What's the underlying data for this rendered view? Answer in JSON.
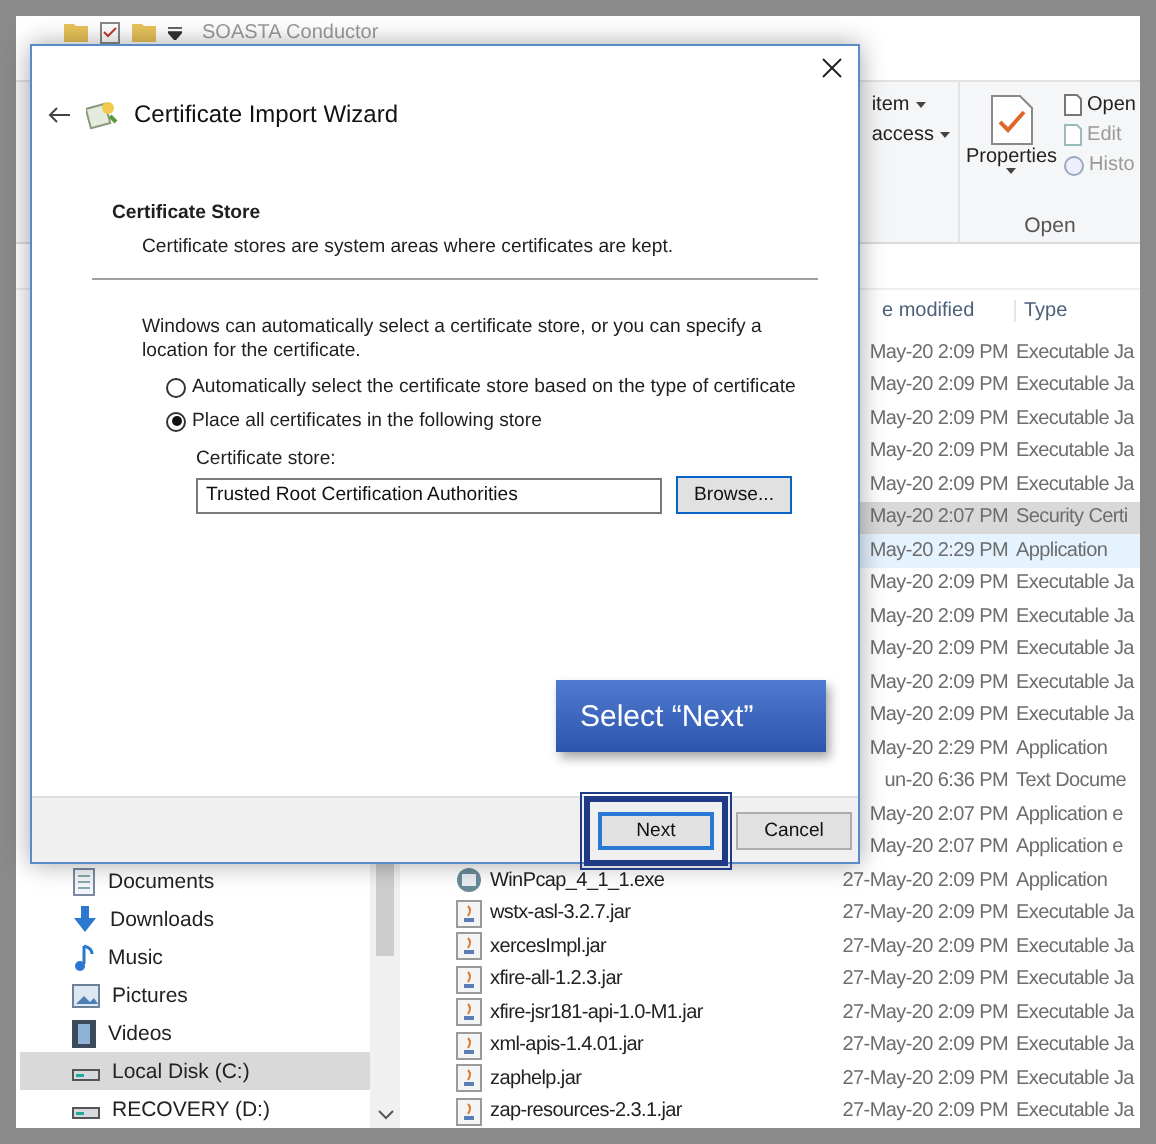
{
  "explorer": {
    "title": "SOASTA Conductor",
    "ribbon": {
      "new_item": "item",
      "easy_access": "access",
      "properties": "Properties",
      "open": "Open",
      "edit": "Edit",
      "history": "Histo",
      "group_label": "Open"
    },
    "columns": [
      "e modified",
      "Type"
    ],
    "sidebar": [
      {
        "label": "Documents",
        "kind": "documents",
        "selected": false
      },
      {
        "label": "Downloads",
        "kind": "downloads",
        "selected": false
      },
      {
        "label": "Music",
        "kind": "music",
        "selected": false
      },
      {
        "label": "Pictures",
        "kind": "pictures",
        "selected": false
      },
      {
        "label": "Videos",
        "kind": "videos",
        "selected": false
      },
      {
        "label": "Local Disk (C:)",
        "kind": "drive",
        "selected": true
      },
      {
        "label": "RECOVERY (D:)",
        "kind": "drive",
        "selected": false
      }
    ],
    "files": [
      {
        "date": "May-20 2:09 PM",
        "type": "Executable Ja",
        "selected": false,
        "hovered": false
      },
      {
        "date": "May-20 2:09 PM",
        "type": "Executable Ja",
        "selected": false,
        "hovered": false
      },
      {
        "date": "May-20 2:09 PM",
        "type": "Executable Ja",
        "selected": false,
        "hovered": false
      },
      {
        "date": "May-20 2:09 PM",
        "type": "Executable Ja",
        "selected": false,
        "hovered": false
      },
      {
        "date": "May-20 2:09 PM",
        "type": "Executable Ja",
        "selected": false,
        "hovered": false
      },
      {
        "date": "May-20 2:07 PM",
        "type": "Security Certi",
        "selected": true,
        "hovered": false
      },
      {
        "date": "May-20 2:29 PM",
        "type": "Application",
        "selected": false,
        "hovered": true
      },
      {
        "date": "May-20 2:09 PM",
        "type": "Executable Ja",
        "selected": false,
        "hovered": false
      },
      {
        "date": "May-20 2:09 PM",
        "type": "Executable Ja",
        "selected": false,
        "hovered": false
      },
      {
        "date": "May-20 2:09 PM",
        "type": "Executable Ja",
        "selected": false,
        "hovered": false
      },
      {
        "date": "May-20 2:09 PM",
        "type": "Executable Ja",
        "selected": false,
        "hovered": false
      },
      {
        "date": "May-20 2:09 PM",
        "type": "Executable Ja",
        "selected": false,
        "hovered": false
      },
      {
        "date": "May-20 2:29 PM",
        "type": "Application",
        "selected": false,
        "hovered": false
      },
      {
        "date": "un-20 6:36 PM",
        "type": "Text Docume",
        "selected": false,
        "hovered": false
      },
      {
        "date": "May-20 2:07 PM",
        "type": "Application e",
        "selected": false,
        "hovered": false
      },
      {
        "date": "May-20 2:07 PM",
        "type": "Application e",
        "selected": false,
        "hovered": false
      },
      {
        "name": "WinPcap_4_1_1.exe",
        "kind": "exe",
        "date": "27-May-20 2:09 PM",
        "type": "Application",
        "selected": false,
        "hovered": false
      },
      {
        "name": "wstx-asl-3.2.7.jar",
        "kind": "jar",
        "date": "27-May-20 2:09 PM",
        "type": "Executable Ja",
        "selected": false,
        "hovered": false
      },
      {
        "name": "xercesImpl.jar",
        "kind": "jar",
        "date": "27-May-20 2:09 PM",
        "type": "Executable Ja",
        "selected": false,
        "hovered": false
      },
      {
        "name": "xfire-all-1.2.3.jar",
        "kind": "jar",
        "date": "27-May-20 2:09 PM",
        "type": "Executable Ja",
        "selected": false,
        "hovered": false
      },
      {
        "name": "xfire-jsr181-api-1.0-M1.jar",
        "kind": "jar",
        "date": "27-May-20 2:09 PM",
        "type": "Executable Ja",
        "selected": false,
        "hovered": false
      },
      {
        "name": "xml-apis-1.4.01.jar",
        "kind": "jar",
        "date": "27-May-20 2:09 PM",
        "type": "Executable Ja",
        "selected": false,
        "hovered": false
      },
      {
        "name": "zaphelp.jar",
        "kind": "jar",
        "date": "27-May-20 2:09 PM",
        "type": "Executable Ja",
        "selected": false,
        "hovered": false
      },
      {
        "name": "zap-resources-2.3.1.jar",
        "kind": "jar",
        "date": "27-May-20 2:09 PM",
        "type": "Executable Ja",
        "selected": false,
        "hovered": false
      }
    ]
  },
  "dialog": {
    "title": "Certificate Import Wizard",
    "heading": "Certificate Store",
    "subheading": "Certificate stores are system areas where certificates are kept.",
    "body": "Windows can automatically select a certificate store, or you can specify a location for the certificate.",
    "options": [
      {
        "label": "Automatically select the certificate store based on the type of certificate",
        "selected": false
      },
      {
        "label": "Place all certificates in the following store",
        "selected": true
      }
    ],
    "field_label": "Certificate store:",
    "field_value": "Trusted Root Certification Authorities",
    "browse": "Browse...",
    "buttons": [
      {
        "label": "Next",
        "focused": true,
        "annotated": true
      },
      {
        "label": "Cancel",
        "focused": false,
        "annotated": false
      }
    ]
  },
  "callout": {
    "text": "Select “Next”"
  }
}
